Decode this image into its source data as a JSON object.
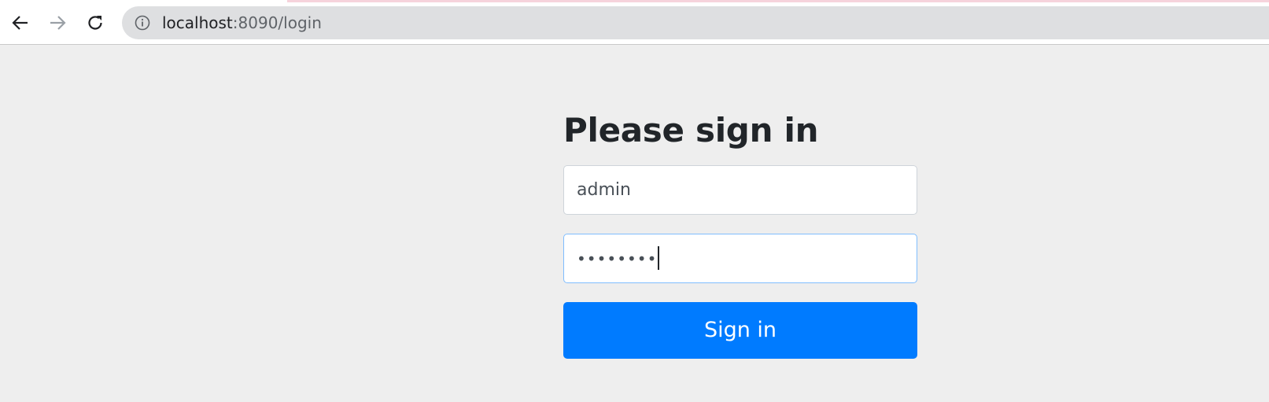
{
  "browser": {
    "url_host": "localhost",
    "url_path": ":8090/login",
    "back_icon": "arrow-left-icon",
    "forward_icon": "arrow-right-icon",
    "reload_icon": "reload-icon",
    "site_info_icon": "info-icon"
  },
  "login_form": {
    "heading": "Please sign in",
    "username_value": "admin",
    "password_value": "••••••••",
    "submit_label": "Sign in"
  },
  "colors": {
    "page_background": "#eeeeee",
    "primary_button": "#007bff",
    "focus_border": "#80bdff"
  }
}
